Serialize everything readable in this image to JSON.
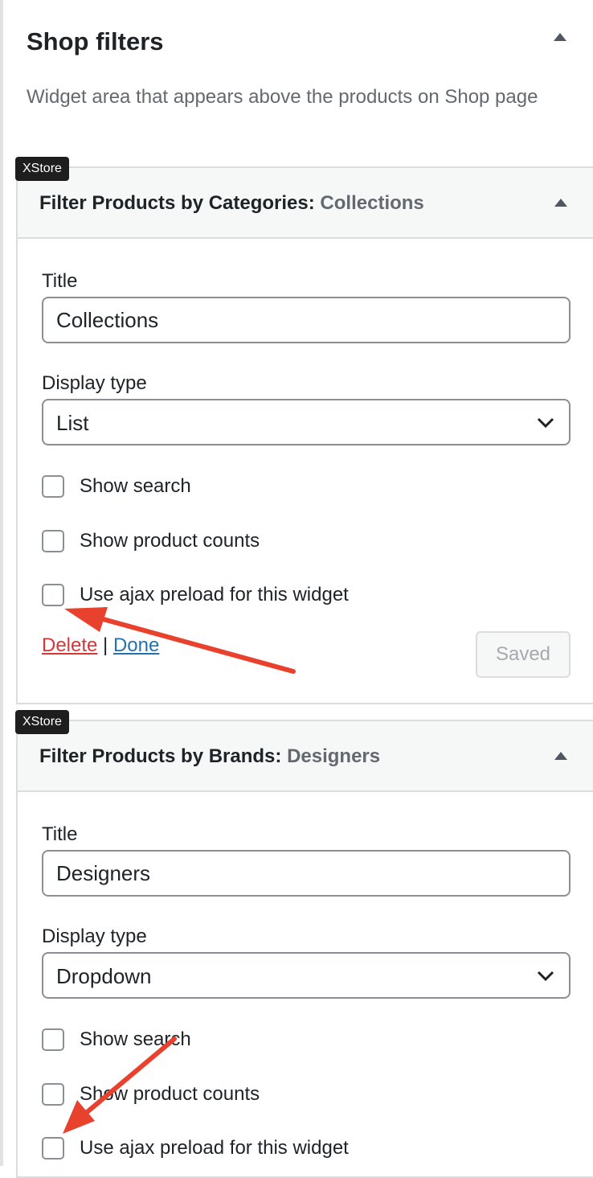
{
  "area": {
    "title": "Shop filters",
    "description": "Widget area that appears above the products on Shop page"
  },
  "widgets": [
    {
      "badge": "XStore",
      "title": "Filter Products by Categories:",
      "subtitle": "Collections",
      "title_label": "Title",
      "title_value": "Collections",
      "display_label": "Display type",
      "display_value": "List",
      "show_search": "Show search",
      "show_counts": "Show product counts",
      "ajax_preload": "Use ajax preload for this widget",
      "delete": "Delete",
      "separator": "|",
      "done": "Done",
      "saved": "Saved"
    },
    {
      "badge": "XStore",
      "title": "Filter Products by Brands:",
      "subtitle": "Designers",
      "title_label": "Title",
      "title_value": "Designers",
      "display_label": "Display type",
      "display_value": "Dropdown",
      "show_search": "Show search",
      "show_counts": "Show product counts",
      "ajax_preload": "Use ajax preload for this widget"
    }
  ],
  "colors": {
    "annotation_arrow": "#e8412d",
    "delete_link": "#d63638",
    "done_link": "#2271b1"
  }
}
